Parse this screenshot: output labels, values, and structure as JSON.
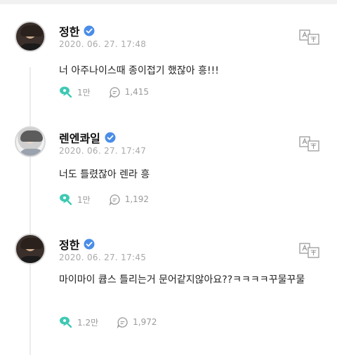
{
  "colors": {
    "accent": "#3ec9b4",
    "verified": "#4a8de8",
    "muted": "#a9a9a9"
  },
  "icons": {
    "verified": "verified-badge-icon",
    "like": "bubble-key-icon",
    "reply": "comment-icon",
    "translate": "translate-icon"
  },
  "comments": [
    {
      "name": "정한",
      "timestamp": "2020. 06. 27. 17:48",
      "text": "너 아주나이스때 종이접기 했잖아 흥!!!",
      "likes": "1만",
      "replies": "1,415"
    },
    {
      "name": "렌엔콰일",
      "timestamp": "2020. 06. 27. 17:47",
      "text": "너도 틀렸잖아 렌라 흥",
      "likes": "1만",
      "replies": "1,192"
    },
    {
      "name": "정한",
      "timestamp": "2020. 06. 27. 17:45",
      "text": "마이마이 큡스 틀리는거 문어같지않아요??ㅋㅋㅋㅋ꾸물꾸물",
      "likes": "1.2만",
      "replies": "1,972"
    }
  ]
}
